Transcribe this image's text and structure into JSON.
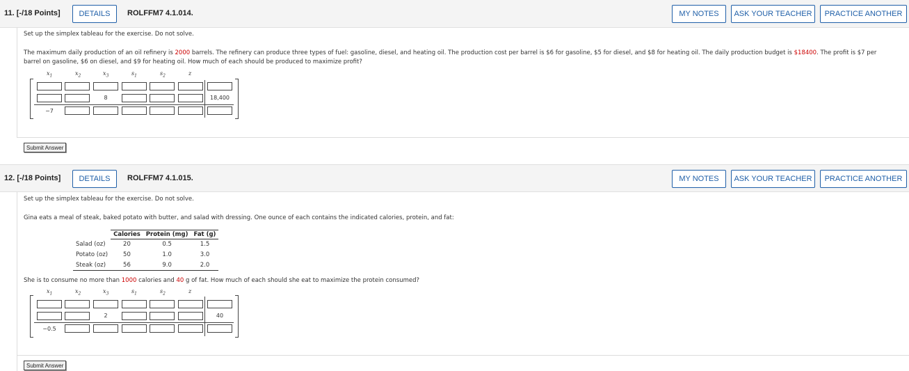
{
  "q11": {
    "number": "11.  [-/18 Points]",
    "details": "DETAILS",
    "code": "ROLFFM7 4.1.014.",
    "my_notes": "MY NOTES",
    "ask_teacher": "ASK YOUR TEACHER",
    "practice": "PRACTICE ANOTHER",
    "instruction": "Set up the simplex tableau for the exercise. Do not solve.",
    "problem_line1_a": "The maximum daily production of an oil refinery is ",
    "problem_line1_red": "2000",
    "problem_line1_b": " barrels. The refinery can produce three types of fuel: gasoline, diesel, and heating oil. The production cost per barrel is $6 for gasoline, $5 for diesel, and $8 for heating oil. The daily production budget is ",
    "problem_line1_red2": "$18400",
    "problem_line1_c": ". The profit is $7 per",
    "problem_line2": "barrel on gasoline, $6 on diesel, and $9 for heating oil. How much of each should be produced to maximize profit?",
    "vars": [
      "x",
      "x",
      "x",
      "s",
      "s",
      "z"
    ],
    "var_subs": [
      "1",
      "2",
      "3",
      "1",
      "2",
      ""
    ],
    "given_x3_row2": "8",
    "given_rhs_row2": "18,400",
    "given_x1_row3": "−7",
    "submit": "Submit Answer"
  },
  "q12": {
    "number": "12.  [-/18 Points]",
    "details": "DETAILS",
    "code": "ROLFFM7 4.1.015.",
    "my_notes": "MY NOTES",
    "ask_teacher": "ASK YOUR TEACHER",
    "practice": "PRACTICE ANOTHER",
    "instruction": "Set up the simplex tableau for the exercise. Do not solve.",
    "problem_intro": "Gina eats a meal of steak, baked potato with butter, and salad with dressing. One ounce of each contains the indicated calories, protein, and fat:",
    "table_headers": [
      "Calories",
      "Protein (mg)",
      "Fat (g)"
    ],
    "table_rows": [
      {
        "label": "Salad (oz)",
        "values": [
          "20",
          "0.5",
          "1.5"
        ]
      },
      {
        "label": "Potato (oz)",
        "values": [
          "50",
          "1.0",
          "3.0"
        ]
      },
      {
        "label": "Steak (oz)",
        "values": [
          "56",
          "9.0",
          "2.0"
        ]
      }
    ],
    "constraint_a": "She is to consume no more than ",
    "constraint_red1": "1000",
    "constraint_b": " calories and ",
    "constraint_red2": "40",
    "constraint_c": " g of fat. How much of each should she eat to maximize the protein consumed?",
    "vars": [
      "x",
      "x",
      "x",
      "s",
      "s",
      "z"
    ],
    "var_subs": [
      "1",
      "2",
      "3",
      "1",
      "2",
      ""
    ],
    "given_x3_row2": "2",
    "given_rhs_row2": "40",
    "given_x1_row3": "−0.5",
    "submit": "Submit Answer"
  }
}
